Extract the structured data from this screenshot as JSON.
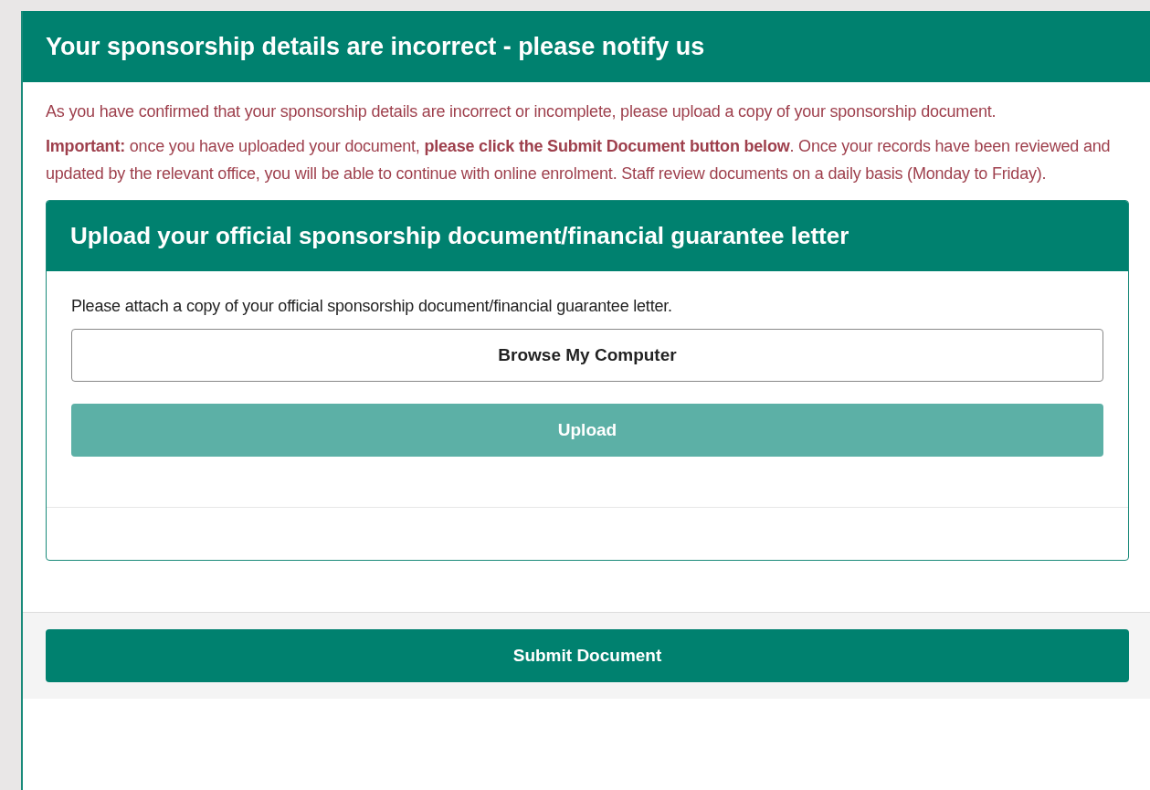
{
  "panel": {
    "title": "Your sponsorship details are incorrect - please notify us",
    "paragraphs": [
      "As you have confirmed that your sponsorship details are incorrect or incomplete, please upload a copy of your sponsorship document.",
      "**Important:** once you have uploaded your document, **please click the Submit Document button below**. Once your records have been reviewed and updated by the relevant office, you will be able to continue with online enrolment. Staff review documents on a daily basis (Monday to Friday)."
    ],
    "upload_card": {
      "title": "Upload your official sponsorship document/financial guarantee letter",
      "instruction": "Please attach a copy of your official sponsorship document/financial guarantee letter.",
      "buttons": [
        {
          "label": "Browse My Computer",
          "kind": "outline",
          "disabled": false
        },
        {
          "label": "Upload",
          "kind": "primary",
          "disabled": true
        }
      ]
    },
    "submit_button": {
      "label": "Submit Document",
      "disabled": false
    }
  }
}
